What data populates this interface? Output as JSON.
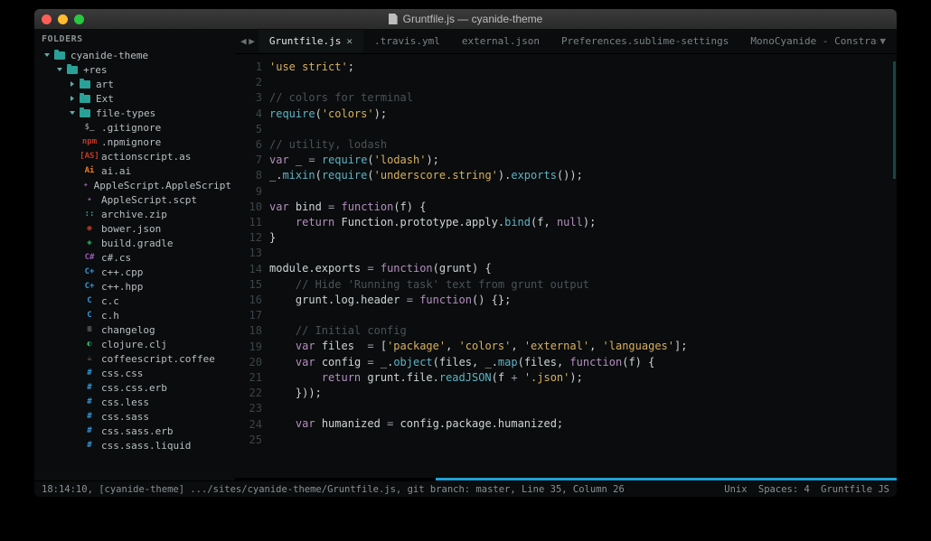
{
  "window_title": "Gruntfile.js — cyanide-theme",
  "folders_header": "FOLDERS",
  "project_name": "cyanide-theme",
  "folders": [
    {
      "name": "+res",
      "open": true,
      "children": [
        {
          "name": "art",
          "type": "folder"
        },
        {
          "name": "Ext",
          "type": "folder"
        },
        {
          "name": "file-types",
          "type": "folder",
          "open": true
        }
      ]
    }
  ],
  "files": [
    {
      "name": ".gitignore",
      "icon": "$_",
      "color": "#7a8285"
    },
    {
      "name": ".npmignore",
      "icon": "npm",
      "color": "#c0392b"
    },
    {
      "name": "actionscript.as",
      "icon": "[AS]",
      "color": "#c0392b"
    },
    {
      "name": "ai.ai",
      "icon": "Ai",
      "color": "#e67e22"
    },
    {
      "name": "AppleScript.AppleScript",
      "icon": "✦",
      "color": "#9b59b6"
    },
    {
      "name": "AppleScript.scpt",
      "icon": "✦",
      "color": "#9b59b6"
    },
    {
      "name": "archive.zip",
      "icon": "::",
      "color": "#2aa198"
    },
    {
      "name": "bower.json",
      "icon": "◉",
      "color": "#c0392b"
    },
    {
      "name": "build.gradle",
      "icon": "◈",
      "color": "#27ae60"
    },
    {
      "name": "c#.cs",
      "icon": "C#",
      "color": "#9b59b6"
    },
    {
      "name": "c++.cpp",
      "icon": "C+",
      "color": "#3498db"
    },
    {
      "name": "c++.hpp",
      "icon": "C+",
      "color": "#3498db"
    },
    {
      "name": "c.c",
      "icon": "C",
      "color": "#3498db"
    },
    {
      "name": "c.h",
      "icon": "C",
      "color": "#3498db"
    },
    {
      "name": "changelog",
      "icon": "≡",
      "color": "#7a8285"
    },
    {
      "name": "clojure.clj",
      "icon": "◐",
      "color": "#27ae60"
    },
    {
      "name": "coffeescript.coffee",
      "icon": "☕",
      "color": "#8b6f47"
    },
    {
      "name": "css.css",
      "icon": "#",
      "color": "#3498db"
    },
    {
      "name": "css.css.erb",
      "icon": "#",
      "color": "#3498db"
    },
    {
      "name": "css.less",
      "icon": "#",
      "color": "#3498db"
    },
    {
      "name": "css.sass",
      "icon": "#",
      "color": "#3498db"
    },
    {
      "name": "css.sass.erb",
      "icon": "#",
      "color": "#3498db"
    },
    {
      "name": "css.sass.liquid",
      "icon": "#",
      "color": "#3498db"
    }
  ],
  "tabs": [
    {
      "label": "Gruntfile.js",
      "active": true,
      "dirty": true
    },
    {
      "label": ".travis.yml"
    },
    {
      "label": "external.json"
    },
    {
      "label": "Preferences.sublime-settings"
    },
    {
      "label": "MonoCyanide - Constrasted Semi.tmTheme"
    }
  ],
  "code_lines": [
    [
      {
        "t": "str",
        "v": "'use strict'"
      },
      {
        "t": "pun",
        "v": ";"
      }
    ],
    [],
    [
      {
        "t": "com",
        "v": "// colors for terminal"
      }
    ],
    [
      {
        "t": "fn",
        "v": "require"
      },
      {
        "t": "pun",
        "v": "("
      },
      {
        "t": "str",
        "v": "'colors'"
      },
      {
        "t": "pun",
        "v": ");"
      }
    ],
    [],
    [
      {
        "t": "com",
        "v": "// utility, lodash"
      }
    ],
    [
      {
        "t": "kw",
        "v": "var"
      },
      {
        "t": "id",
        "v": " _ "
      },
      {
        "t": "op",
        "v": "="
      },
      {
        "t": "id",
        "v": " "
      },
      {
        "t": "fn",
        "v": "require"
      },
      {
        "t": "pun",
        "v": "("
      },
      {
        "t": "str",
        "v": "'lodash'"
      },
      {
        "t": "pun",
        "v": ");"
      }
    ],
    [
      {
        "t": "id",
        "v": "_."
      },
      {
        "t": "fn",
        "v": "mixin"
      },
      {
        "t": "pun",
        "v": "("
      },
      {
        "t": "fn",
        "v": "require"
      },
      {
        "t": "pun",
        "v": "("
      },
      {
        "t": "str",
        "v": "'underscore.string'"
      },
      {
        "t": "pun",
        "v": ")."
      },
      {
        "t": "fn",
        "v": "exports"
      },
      {
        "t": "pun",
        "v": "());"
      }
    ],
    [],
    [
      {
        "t": "kw",
        "v": "var"
      },
      {
        "t": "id",
        "v": " bind "
      },
      {
        "t": "op",
        "v": "="
      },
      {
        "t": "id",
        "v": " "
      },
      {
        "t": "kw",
        "v": "function"
      },
      {
        "t": "pun",
        "v": "("
      },
      {
        "t": "id",
        "v": "f"
      },
      {
        "t": "pun",
        "v": ") {"
      }
    ],
    [
      {
        "t": "id",
        "v": "    "
      },
      {
        "t": "kw",
        "v": "return"
      },
      {
        "t": "id",
        "v": " Function.prototype.apply."
      },
      {
        "t": "fn",
        "v": "bind"
      },
      {
        "t": "pun",
        "v": "("
      },
      {
        "t": "id",
        "v": "f"
      },
      {
        "t": "pun",
        "v": ", "
      },
      {
        "t": "kw",
        "v": "null"
      },
      {
        "t": "pun",
        "v": ");"
      }
    ],
    [
      {
        "t": "pun",
        "v": "}"
      }
    ],
    [],
    [
      {
        "t": "id",
        "v": "module.exports "
      },
      {
        "t": "op",
        "v": "="
      },
      {
        "t": "id",
        "v": " "
      },
      {
        "t": "kw",
        "v": "function"
      },
      {
        "t": "pun",
        "v": "("
      },
      {
        "t": "id",
        "v": "grunt"
      },
      {
        "t": "pun",
        "v": ") {"
      }
    ],
    [
      {
        "t": "id",
        "v": "    "
      },
      {
        "t": "com",
        "v": "// Hide 'Running task' text from grunt output"
      }
    ],
    [
      {
        "t": "id",
        "v": "    grunt.log.header "
      },
      {
        "t": "op",
        "v": "="
      },
      {
        "t": "id",
        "v": " "
      },
      {
        "t": "kw",
        "v": "function"
      },
      {
        "t": "pun",
        "v": "() {};"
      }
    ],
    [],
    [
      {
        "t": "id",
        "v": "    "
      },
      {
        "t": "com",
        "v": "// Initial config"
      }
    ],
    [
      {
        "t": "id",
        "v": "    "
      },
      {
        "t": "kw",
        "v": "var"
      },
      {
        "t": "id",
        "v": " files  "
      },
      {
        "t": "op",
        "v": "="
      },
      {
        "t": "pun",
        "v": " ["
      },
      {
        "t": "str",
        "v": "'package'"
      },
      {
        "t": "pun",
        "v": ", "
      },
      {
        "t": "str",
        "v": "'colors'"
      },
      {
        "t": "pun",
        "v": ", "
      },
      {
        "t": "str",
        "v": "'external'"
      },
      {
        "t": "pun",
        "v": ", "
      },
      {
        "t": "str",
        "v": "'languages'"
      },
      {
        "t": "pun",
        "v": "];"
      }
    ],
    [
      {
        "t": "id",
        "v": "    "
      },
      {
        "t": "kw",
        "v": "var"
      },
      {
        "t": "id",
        "v": " config "
      },
      {
        "t": "op",
        "v": "="
      },
      {
        "t": "id",
        "v": " _."
      },
      {
        "t": "fn",
        "v": "object"
      },
      {
        "t": "pun",
        "v": "(files, _."
      },
      {
        "t": "fn",
        "v": "map"
      },
      {
        "t": "pun",
        "v": "(files, "
      },
      {
        "t": "kw",
        "v": "function"
      },
      {
        "t": "pun",
        "v": "("
      },
      {
        "t": "id",
        "v": "f"
      },
      {
        "t": "pun",
        "v": ") {"
      }
    ],
    [
      {
        "t": "id",
        "v": "        "
      },
      {
        "t": "kw",
        "v": "return"
      },
      {
        "t": "id",
        "v": " grunt.file."
      },
      {
        "t": "fn",
        "v": "readJSON"
      },
      {
        "t": "pun",
        "v": "(f "
      },
      {
        "t": "op",
        "v": "+"
      },
      {
        "t": "pun",
        "v": " "
      },
      {
        "t": "str",
        "v": "'.json'"
      },
      {
        "t": "pun",
        "v": ");"
      }
    ],
    [
      {
        "t": "id",
        "v": "    }));"
      }
    ],
    [],
    [
      {
        "t": "id",
        "v": "    "
      },
      {
        "t": "kw",
        "v": "var"
      },
      {
        "t": "id",
        "v": " humanized "
      },
      {
        "t": "op",
        "v": "="
      },
      {
        "t": "id",
        "v": " config.package.humanized;"
      }
    ],
    []
  ],
  "status": {
    "left": "18:14:10, [cyanide-theme] .../sites/cyanide-theme/Gruntfile.js, git branch: master, Line 35, Column 26",
    "right_a": "Unix",
    "right_b": "Spaces: 4",
    "right_c": "Gruntfile JS"
  }
}
